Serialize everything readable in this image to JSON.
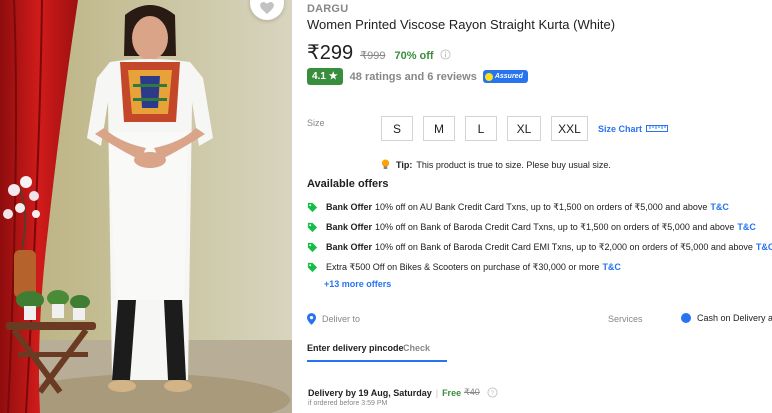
{
  "product": {
    "brand": "DARGU",
    "title": "Women Printed Viscose Rayon Straight Kurta  (White)",
    "price": "₹299",
    "mrp": "₹999",
    "discount": "70% off"
  },
  "rating": {
    "score": "4.1",
    "star": "★",
    "summary": "48 ratings and 6 reviews",
    "assured_label": "Assured"
  },
  "sizes": {
    "label": "Size",
    "options": [
      "S",
      "M",
      "L",
      "XL",
      "XXL"
    ],
    "chart_link": "Size Chart"
  },
  "tip": {
    "label": "Tip:",
    "text": "This product is true to size. Plese buy usual size."
  },
  "offers": {
    "heading": "Available offers",
    "items": [
      {
        "type": "Bank Offer",
        "text": "10% off on AU Bank Credit Card Txns, up to ₹1,500 on orders of ₹5,000 and above",
        "link": "T&C"
      },
      {
        "type": "Bank Offer",
        "text": "10% off on Bank of Baroda Credit Card Txns, up to ₹1,500 on orders of ₹5,000 and above",
        "link": "T&C"
      },
      {
        "type": "Bank Offer",
        "text": "10% off on Bank of Baroda Credit Card EMI Txns, up to ₹2,000 on orders of ₹5,000 and above",
        "link": "T&C"
      },
      {
        "type": "",
        "text": "Extra ₹500 Off on Bikes & Scooters on purchase of ₹30,000 or more",
        "link": "T&C"
      }
    ],
    "more": "+13 more offers"
  },
  "delivery": {
    "deliver_to": "Deliver to",
    "pincode_placeholder": "Enter delivery pincode",
    "check": "Check",
    "estimate": "Delivery by 19 Aug, Saturday",
    "separator": "|",
    "free": "Free",
    "old_fee": "₹40",
    "cutoff": "if ordered before 3:59 PM"
  },
  "services": {
    "label": "Services",
    "cod": "Cash on Delivery a"
  },
  "colors": {
    "accent": "#2874f0",
    "green": "#388e3c",
    "muted": "#878787"
  }
}
